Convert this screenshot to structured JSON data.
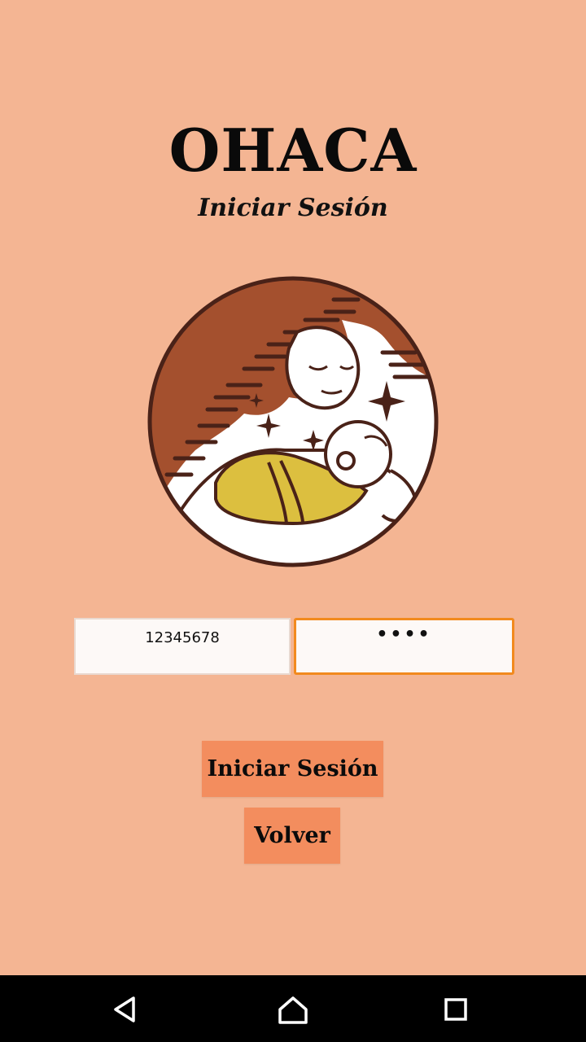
{
  "app": {
    "title": "OHACA",
    "subtitle": "Iniciar Sesión"
  },
  "form": {
    "username_value": "12345678",
    "password_value": "••••"
  },
  "buttons": {
    "login_label": "Iniciar Sesión",
    "back_label": "Volver"
  },
  "logo": {
    "icon": "mother-holding-baby-logo"
  },
  "navbar": {
    "back_icon": "triangle-back-icon",
    "home_icon": "home-icon",
    "recent_icon": "square-recents-icon"
  },
  "colors": {
    "background": "#f4b593",
    "button": "#f38d5e",
    "focus_border": "#f28a1e",
    "logo_brown": "#a4502e",
    "logo_yellow": "#dcbf3f",
    "logo_outline": "#4a2218"
  }
}
